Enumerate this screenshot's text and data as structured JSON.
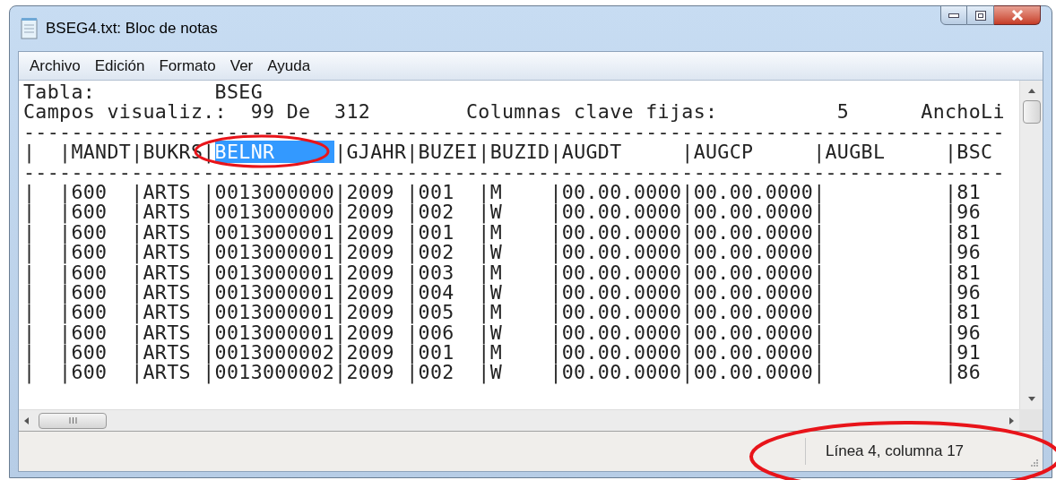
{
  "window": {
    "title": "BSEG4.txt: Bloc de notas"
  },
  "menu": [
    "Archivo",
    "Edición",
    "Formato",
    "Ver",
    "Ayuda"
  ],
  "editor": {
    "lines": [
      {
        "segments": [
          {
            "text": "Tabla:          BSEG",
            "selected": false
          }
        ]
      },
      {
        "segments": [
          {
            "text": "Campos visualiz.:  99 De  312        Columnas clave fijas:          5      AnchoLi",
            "selected": false
          }
        ]
      },
      {
        "segments": [
          {
            "text": "----------------------------------------------------------------------------------",
            "selected": false
          }
        ]
      },
      {
        "segments": [
          {
            "text": "|  |MANDT|BUKRS|",
            "selected": false
          },
          {
            "text": "BELNR     ",
            "selected": true
          },
          {
            "text": "|GJAHR|BUZEI|BUZID|AUGDT     |AUGCP     |AUGBL     |BSC",
            "selected": false
          }
        ]
      },
      {
        "segments": [
          {
            "text": "----------------------------------------------------------------------------------",
            "selected": false
          }
        ]
      },
      {
        "segments": [
          {
            "text": "|  |600  |ARTS |0013000000|2009 |001  |M    |00.00.0000|00.00.0000|          |81",
            "selected": false
          }
        ]
      },
      {
        "segments": [
          {
            "text": "|  |600  |ARTS |0013000000|2009 |002  |W    |00.00.0000|00.00.0000|          |96",
            "selected": false
          }
        ]
      },
      {
        "segments": [
          {
            "text": "|  |600  |ARTS |0013000001|2009 |001  |M    |00.00.0000|00.00.0000|          |81",
            "selected": false
          }
        ]
      },
      {
        "segments": [
          {
            "text": "|  |600  |ARTS |0013000001|2009 |002  |W    |00.00.0000|00.00.0000|          |96",
            "selected": false
          }
        ]
      },
      {
        "segments": [
          {
            "text": "|  |600  |ARTS |0013000001|2009 |003  |M    |00.00.0000|00.00.0000|          |81",
            "selected": false
          }
        ]
      },
      {
        "segments": [
          {
            "text": "|  |600  |ARTS |0013000001|2009 |004  |W    |00.00.0000|00.00.0000|          |96",
            "selected": false
          }
        ]
      },
      {
        "segments": [
          {
            "text": "|  |600  |ARTS |0013000001|2009 |005  |M    |00.00.0000|00.00.0000|          |81",
            "selected": false
          }
        ]
      },
      {
        "segments": [
          {
            "text": "|  |600  |ARTS |0013000001|2009 |006  |W    |00.00.0000|00.00.0000|          |96",
            "selected": false
          }
        ]
      },
      {
        "segments": [
          {
            "text": "|  |600  |ARTS |0013000002|2009 |001  |M    |00.00.0000|00.00.0000|          |91",
            "selected": false
          }
        ]
      },
      {
        "segments": [
          {
            "text": "|  |600  |ARTS |0013000002|2009 |002  |W    |00.00.0000|00.00.0000|          |86",
            "selected": false
          }
        ]
      }
    ]
  },
  "status_bar": {
    "position": "Línea 4, columna 17"
  }
}
